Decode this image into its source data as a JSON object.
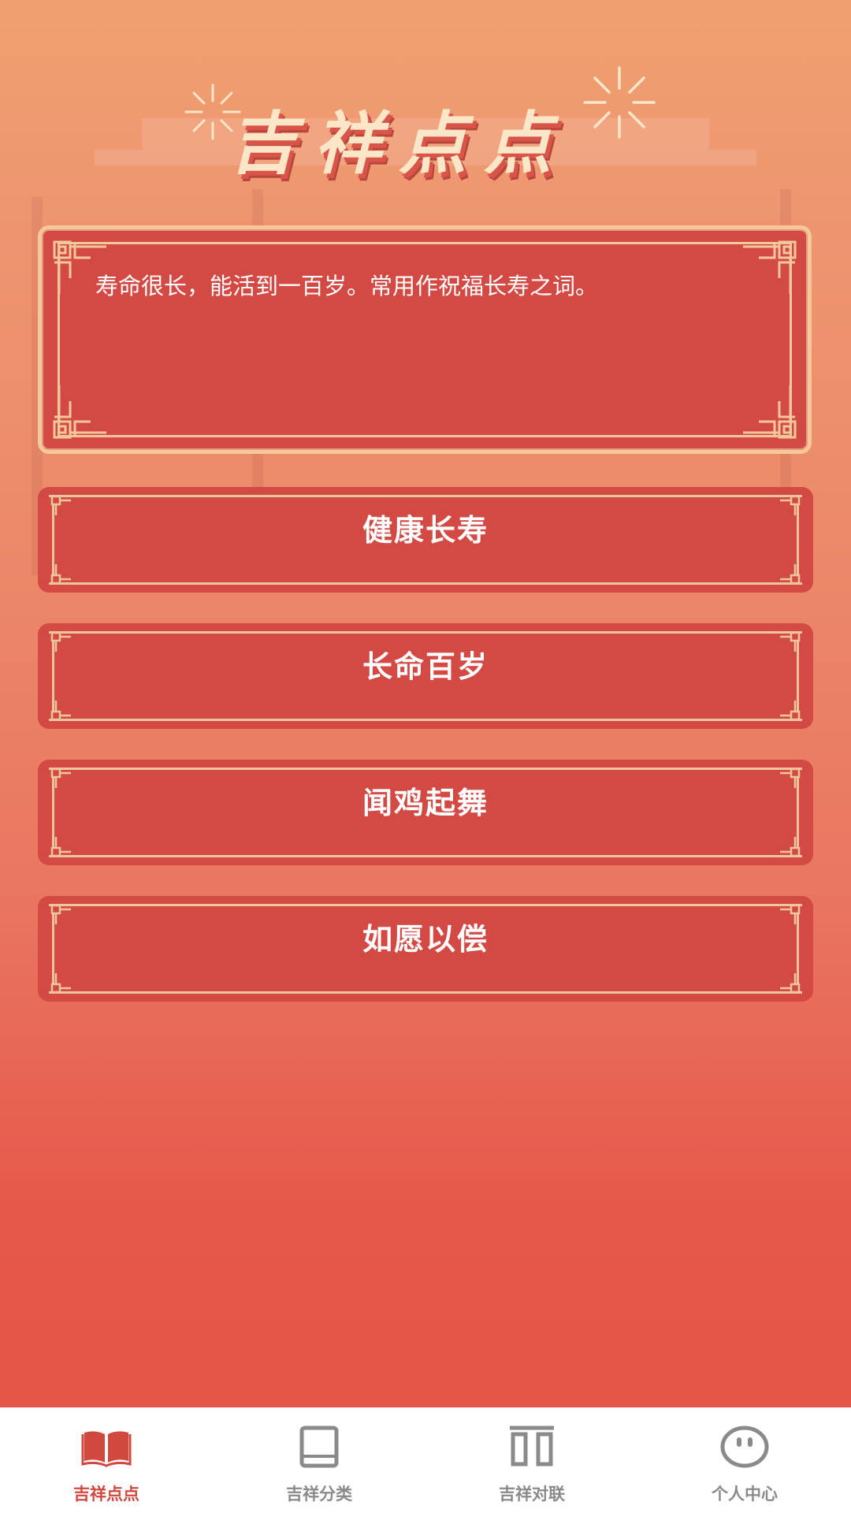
{
  "app": {
    "title": "吉祥点点"
  },
  "card": {
    "description": "寿命很长，能活到一百岁。常用作祝福长寿之词。"
  },
  "options": [
    {
      "label": "健康长寿"
    },
    {
      "label": "长命百岁"
    },
    {
      "label": "闻鸡起舞"
    },
    {
      "label": "如愿以偿"
    }
  ],
  "tabbar": {
    "items": [
      {
        "label": "吉祥点点",
        "icon": "open-book-icon",
        "active": true
      },
      {
        "label": "吉祥分类",
        "icon": "book-icon",
        "active": false
      },
      {
        "label": "吉祥对联",
        "icon": "couplet-icon",
        "active": false
      },
      {
        "label": "个人中心",
        "icon": "face-icon",
        "active": false
      }
    ]
  },
  "colors": {
    "accent": "#d1483f",
    "card": "#d34a44",
    "gold": "#f5c89a",
    "inactive": "#8a8a8a"
  }
}
